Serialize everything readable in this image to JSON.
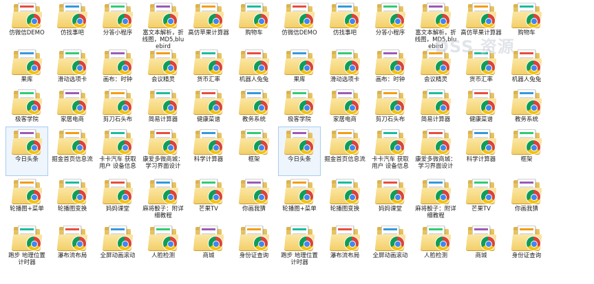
{
  "watermark": "DSS 资源",
  "rows": [
    [
      "仿微信DEMO",
      "仿找事吧",
      "分答小程序",
      "富文本解析，折线图，MD5,bluebird",
      "高仿苹果计算器",
      "购物车",
      "仿微信DEMO",
      "仿找事吧",
      "分答小程序",
      "富文本解析，折线图，MD5,bluebird",
      "高仿苹果计算器",
      "购物车"
    ],
    [
      "果库",
      "滑动选项卡",
      "画布：时钟",
      "会议精灵",
      "货币汇率",
      "机器人兔兔",
      "果库",
      "滑动选项卡",
      "画布：时钟",
      "会议精灵",
      "货币汇率",
      "机器人兔兔"
    ],
    [
      "极客学院",
      "家居电商",
      "剪刀石头布",
      "简易计算器",
      "健康菜谱",
      "教务系统",
      "极客学院",
      "家居电商",
      "剪刀石头布",
      "简易计算器",
      "健康菜谱",
      "教务系统"
    ],
    [
      "今日头条",
      "掘金首页信息流",
      "卡卡汽车 获取用户 设备信息",
      "康爱多微商城：学习界面设计",
      "科学计算器",
      "框架",
      "今日头条",
      "掘金首页信息流",
      "卡卡汽车 获取用户 设备信息",
      "康爱多微商城：学习界面设计",
      "科学计算器",
      "框架"
    ],
    [
      "轮播图+菜单",
      "轮播图变换",
      "妈妈课堂",
      "麻将骰子：附详细教程",
      "芒果TV",
      "你画我猜",
      "轮播图+菜单",
      "轮播图变换",
      "妈妈课堂",
      "麻将骰子：附详细教程",
      "芒果TV",
      "你画我猜"
    ],
    [
      "跑步 地理位置 计时器",
      "瀑布流布局",
      "全屏动画滚动",
      "人脸检测",
      "商城",
      "身份证查询",
      "跑步 地理位置 计时器",
      "瀑布流布局",
      "全屏动画滚动",
      "人脸检测",
      "商城",
      "身份证查询"
    ]
  ],
  "selected": [
    [
      3,
      0
    ],
    [
      3,
      6
    ]
  ],
  "colors": {
    "selection_bg": "#eef5fd",
    "selection_border": "#a8cdee",
    "folder": "#f3cf6a"
  }
}
